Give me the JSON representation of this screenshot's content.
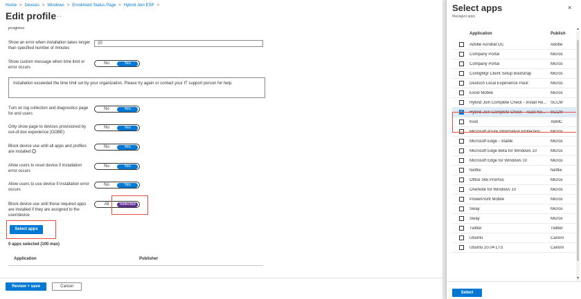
{
  "breadcrumb": [
    "Home",
    "Devices",
    "Windows",
    "Enrollment Status Page",
    "Hybrid Join ESP"
  ],
  "page_title": "Edit profile",
  "title_more": "···",
  "clipped_text": "progress",
  "settings": {
    "error_time_label": "Show an error when installation takes longer than specified number of minutes",
    "error_time_value": "20",
    "custom_msg_label": "Show custom message when time limit or error occurs",
    "custom_msg_text": "Installation exceeded the time limit set by your organization. Please try again or contact your IT support person for help.",
    "log_label": "Turn on log collection and diagnostics page for end users",
    "oobe_label": "Only show page to devices provisioned by out-of-box experience (OOBE)",
    "block_all_label": "Block device use until all apps and profiles are installed",
    "reset_label": "Allow users to reset device if installation error occurs",
    "use_label": "Allow users to use device if installation error occurs",
    "required_label": "Block device use until these required apps are installed if they are assigned to the user/device",
    "no": "No",
    "yes": "Yes",
    "all": "All",
    "selected": "Selected",
    "info_icon": "i"
  },
  "select_apps_button": "Select apps",
  "apps_count": "0 apps selected (100 max)",
  "table": {
    "col_app": "Application",
    "col_pub": "Publisher"
  },
  "footer": {
    "review_save": "Review + save",
    "cancel": "Cancel"
  },
  "panel": {
    "title": "Select apps",
    "subtitle": "Managed apps",
    "close": "×",
    "col_app": "Application",
    "col_pub": "Publish",
    "select_button": "Select",
    "items": [
      {
        "name": "Adobe Acrobat DC",
        "pub": "Adobe"
      },
      {
        "name": "Company Portal",
        "pub": "Micros"
      },
      {
        "name": "Company Portal",
        "pub": "Micros"
      },
      {
        "name": "ConfigMgr Client Setup Bootstrap",
        "pub": "Micros"
      },
      {
        "name": "Deutsch Local Experience Pack",
        "pub": "Micros"
      },
      {
        "name": "Excel Mobile",
        "pub": "Micros"
      },
      {
        "name": "Hybrid Join Complete Check - Install Re...",
        "pub": "SCCM"
      },
      {
        "name": "Hybrid Join Complete Check - Toast No...",
        "pub": "SCCM"
      },
      {
        "name": "Kodi",
        "pub": "XBMC"
      },
      {
        "name": "Microsoft Azure Information Protection",
        "pub": "Micros"
      },
      {
        "name": "Microsoft Edge - Stable",
        "pub": "Micros"
      },
      {
        "name": "Microsoft Edge Beta for Windows 10",
        "pub": "Micros"
      },
      {
        "name": "Microsoft Edge for Windows 10",
        "pub": "Micros"
      },
      {
        "name": "Netflix",
        "pub": "Netflix"
      },
      {
        "name": "Office 365 ProPlus",
        "pub": "Micros"
      },
      {
        "name": "OneNote for Windows 10",
        "pub": "Micros"
      },
      {
        "name": "PowerPoint Mobile",
        "pub": "Micros"
      },
      {
        "name": "Sway",
        "pub": "Micros"
      },
      {
        "name": "Sway",
        "pub": "Micros"
      },
      {
        "name": "Twitter",
        "pub": "Twitter"
      },
      {
        "name": "Ubuntu",
        "pub": "Canoni"
      },
      {
        "name": "Ubuntu 20.04 LTS",
        "pub": "Canoni"
      }
    ],
    "checked_index": 7
  },
  "colors": {
    "accent": "#0078d4",
    "selected_toggle": "#5c2d91",
    "highlight_box": "#e74c3c"
  }
}
